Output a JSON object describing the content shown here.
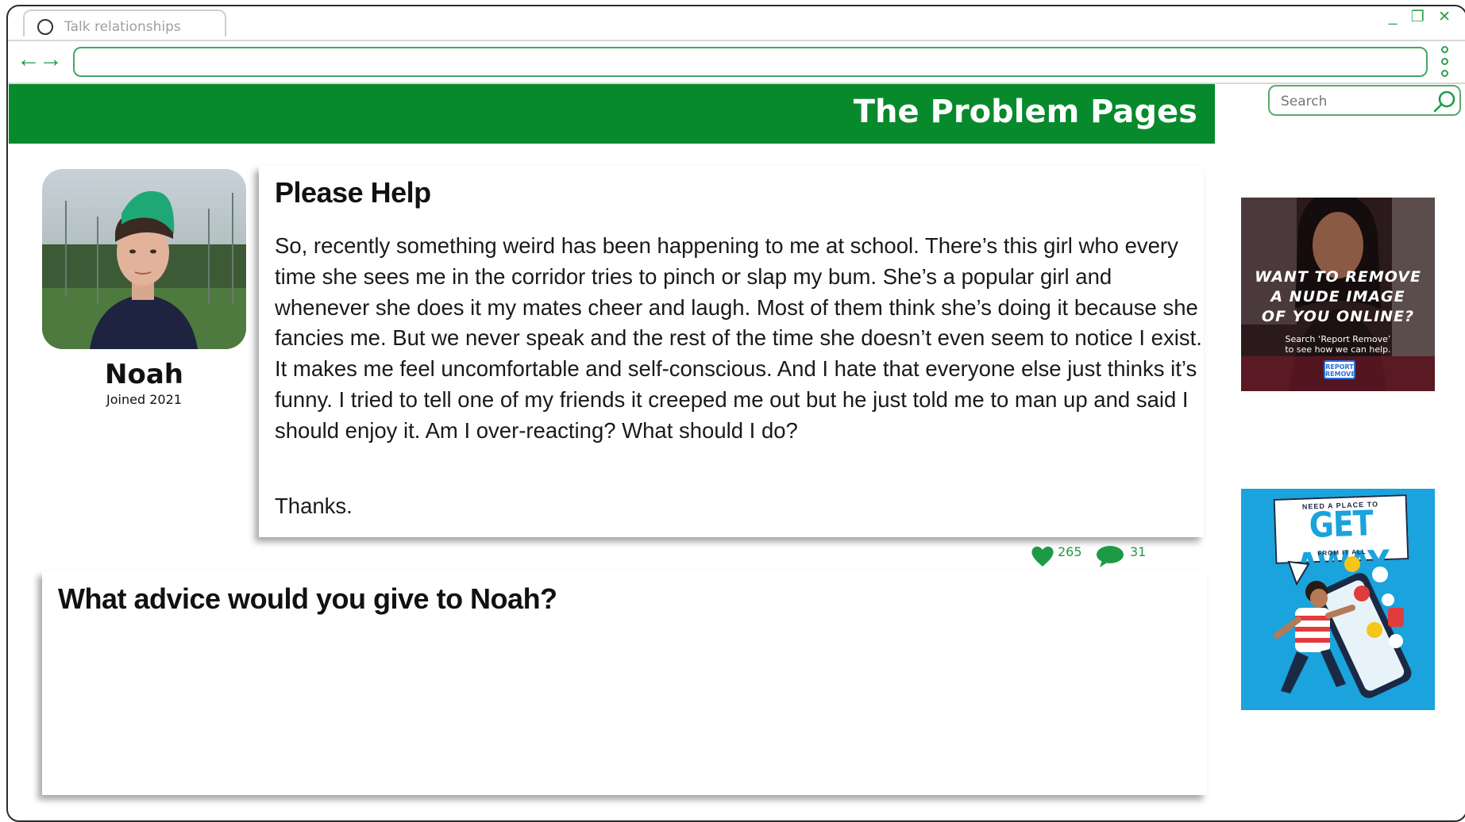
{
  "browser": {
    "tab_title": "Talk relationships",
    "window_controls": "_ ❐ ✕",
    "nav_arrows": "←→",
    "url": ""
  },
  "header": {
    "title": "The Problem Pages"
  },
  "search": {
    "placeholder": "Search"
  },
  "profile": {
    "name": "Noah",
    "joined": "Joined 2021"
  },
  "post": {
    "title": "Please Help",
    "body": "So, recently something weird has been happening to me at school. There’s this girl who every time she sees me in the corridor tries to pinch or slap my bum. She’s a popular girl and whenever she does it my mates cheer and laugh. Most of them think she’s doing it because she fancies me. But we never speak and the rest of the time she doesn’t even seem to notice I exist. It makes me feel uncomfortable and self-conscious. And I hate that everyone else just thinks it’s funny. I tried to tell one of my friends it creeped me out but he just told me to man up and said I should enjoy it. Am I over-reacting?  What should I do?",
    "signoff": "Thanks.",
    "likes": "265",
    "comments": "31"
  },
  "advice": {
    "title": "What advice would you give to Noah?",
    "value": ""
  },
  "ads": {
    "report_remove": {
      "headline_1": "WANT TO REMOVE",
      "headline_2": "A NUDE IMAGE",
      "headline_3": "OF YOU ONLINE?",
      "sub_1": "Search ‘Report Remove’",
      "sub_2": "to see how we can help.",
      "badge_1": "REPORT",
      "badge_2": "REMOVE"
    },
    "get_away": {
      "small_top": "NEED A PLACE TO",
      "big": "GET AWAY",
      "small_bottom": "FROM IT ALL"
    }
  },
  "colors": {
    "brand_green": "#078a2c",
    "accent_green": "#1e9a46",
    "ad_blue": "#1aa3dc"
  },
  "icons": [
    "tab-circle-icon",
    "back-arrow-icon",
    "forward-arrow-icon",
    "kebab-menu-icon",
    "search-icon",
    "heart-icon",
    "comment-icon"
  ]
}
